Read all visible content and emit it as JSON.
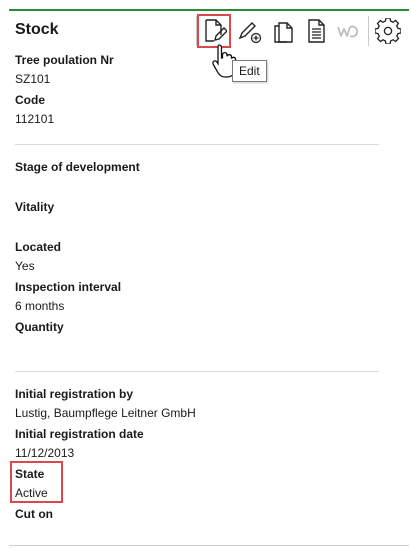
{
  "header": {
    "title": "Stock",
    "accent_color": "#2e8b3a",
    "highlight_color": "#d9484d",
    "toolbar": [
      {
        "icon": "edit-document-icon"
      },
      {
        "icon": "pencil-add-icon"
      },
      {
        "icon": "copy-icon"
      },
      {
        "icon": "document-icon"
      },
      {
        "icon": "wd-icon"
      },
      {
        "icon": "gear-icon"
      }
    ],
    "tooltip": "Edit"
  },
  "section1": {
    "tree_population_label": "Tree poulation Nr",
    "tree_population_value": "SZ101",
    "code_label": "Code",
    "code_value": "112101"
  },
  "section2": {
    "stage_label": "Stage of development",
    "vitality_label": "Vitality",
    "located_label": "Located",
    "located_value": "Yes",
    "inspection_label": "Inspection interval",
    "inspection_value": "6 months",
    "quantity_label": "Quantity"
  },
  "section3": {
    "registration_by_label": "Initial registration by",
    "registration_by_value": "Lustig, Baumpflege Leitner GmbH",
    "registration_date_label": "Initial registration date",
    "registration_date_value": "11/12/2013",
    "state_label": "State",
    "state_value": "Active",
    "cut_on_label": "Cut on"
  }
}
